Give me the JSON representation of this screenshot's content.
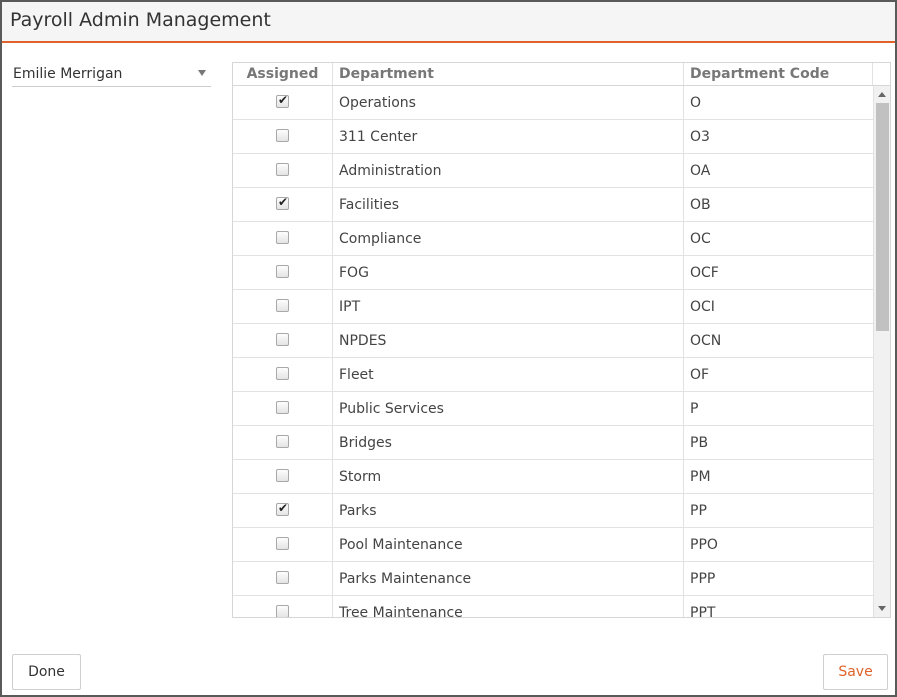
{
  "window": {
    "title": "Payroll Admin Management"
  },
  "user_select": {
    "value": "Emilie Merrigan"
  },
  "grid": {
    "columns": {
      "assigned": "Assigned",
      "department": "Department",
      "code": "Department Code"
    },
    "rows": [
      {
        "assigned": true,
        "department": "Operations",
        "code": "O"
      },
      {
        "assigned": false,
        "department": "311 Center",
        "code": "O3"
      },
      {
        "assigned": false,
        "department": "Administration",
        "code": "OA"
      },
      {
        "assigned": true,
        "department": "Facilities",
        "code": "OB"
      },
      {
        "assigned": false,
        "department": "Compliance",
        "code": "OC"
      },
      {
        "assigned": false,
        "department": "FOG",
        "code": "OCF"
      },
      {
        "assigned": false,
        "department": "IPT",
        "code": "OCI"
      },
      {
        "assigned": false,
        "department": "NPDES",
        "code": "OCN"
      },
      {
        "assigned": false,
        "department": "Fleet",
        "code": "OF"
      },
      {
        "assigned": false,
        "department": "Public Services",
        "code": "P"
      },
      {
        "assigned": false,
        "department": "Bridges",
        "code": "PB"
      },
      {
        "assigned": false,
        "department": "Storm",
        "code": "PM"
      },
      {
        "assigned": true,
        "department": "Parks",
        "code": "PP"
      },
      {
        "assigned": false,
        "department": "Pool Maintenance",
        "code": "PPO"
      },
      {
        "assigned": false,
        "department": "Parks Maintenance",
        "code": "PPP"
      },
      {
        "assigned": false,
        "department": "Tree Maintenance",
        "code": "PPT"
      }
    ]
  },
  "buttons": {
    "done": "Done",
    "save": "Save"
  },
  "colors": {
    "accent": "#e0622a",
    "border": "#5a5a5a",
    "grid_line": "#e2e2e2"
  },
  "icons": {
    "dropdown": "chevron-down-icon",
    "checkbox_mark": "check-icon",
    "scroll_up": "arrow-up-icon",
    "scroll_down": "arrow-down-icon"
  }
}
